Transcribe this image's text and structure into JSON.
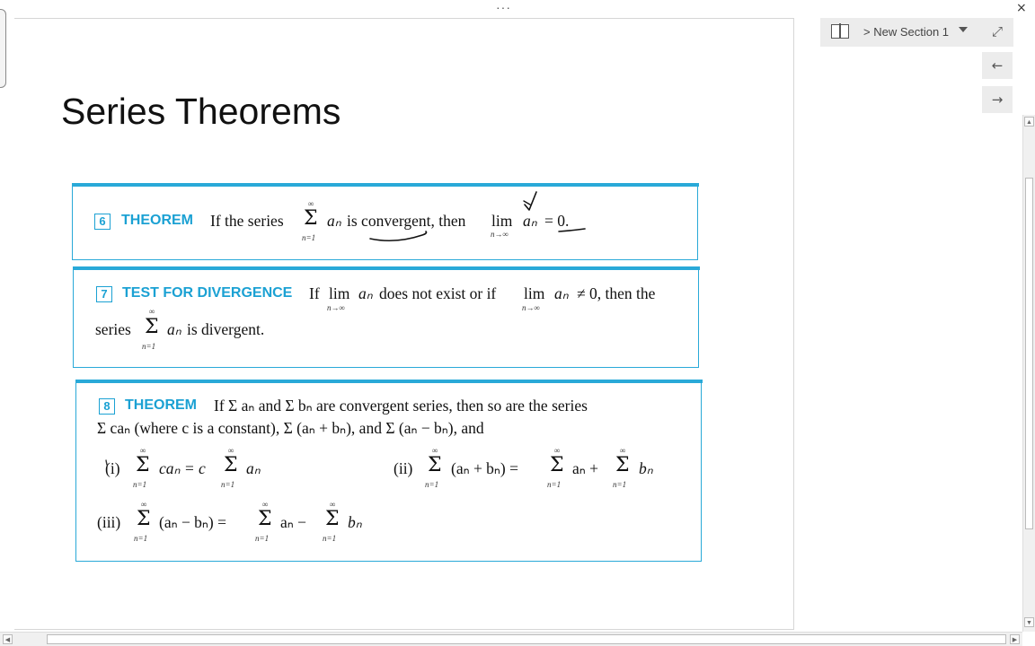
{
  "window": {
    "overflow_dots": "···",
    "close_glyph": "×"
  },
  "section": {
    "label": "> New Section 1"
  },
  "side_buttons": {
    "expand": "⤢",
    "back": "←",
    "forward": "→"
  },
  "slide": {
    "title": "Series Theorems",
    "theorem6": {
      "number": "6",
      "heading": "THEOREM",
      "if_the_series": "If the series",
      "sum_top": "∞",
      "sum_bottom": "n=1",
      "sigma": "Σ",
      "a_n": "aₙ",
      "is_convergent": "is convergent, then",
      "lim": "lim",
      "lim_sub": "n→∞",
      "equals_zero": "= 0."
    },
    "theorem7": {
      "number": "7",
      "heading": "TEST FOR DIVERGENCE",
      "if": "If",
      "lim": "lim",
      "lim_sub": "n→∞",
      "a_n": "aₙ",
      "does_not_exist": "does not exist or if",
      "neq_zero": "≠ 0, then the",
      "series": "series",
      "sigma": "Σ",
      "sum_top": "∞",
      "sum_bottom": "n=1",
      "is_divergent": "is divergent."
    },
    "theorem8": {
      "number": "8",
      "heading": "THEOREM",
      "line1": "If Σ aₙ and Σ bₙ are convergent series, then so are the series",
      "line2": "Σ caₙ (where c is a constant), Σ (aₙ + bₙ), and Σ (aₙ − bₙ), and",
      "i_label": "(i)",
      "i_expr_left": "caₙ = c",
      "i_expr_right": "aₙ",
      "ii_label": "(ii)",
      "ii_expr_left": "(aₙ + bₙ) =",
      "ii_expr_mid": "aₙ +",
      "ii_expr_right": "bₙ",
      "iii_label": "(iii)",
      "iii_expr_left": "(aₙ − bₙ) =",
      "iii_expr_mid": "aₙ −",
      "iii_expr_right": "bₙ",
      "sigma": "Σ",
      "sum_top": "∞",
      "sum_bottom": "n=1"
    }
  },
  "colors": {
    "accent": "#1ba1d3",
    "box_border": "#29a9d8",
    "ink": "#111111"
  },
  "scroll": {
    "up": "▲",
    "down": "▼",
    "left": "◀",
    "right": "▶"
  }
}
